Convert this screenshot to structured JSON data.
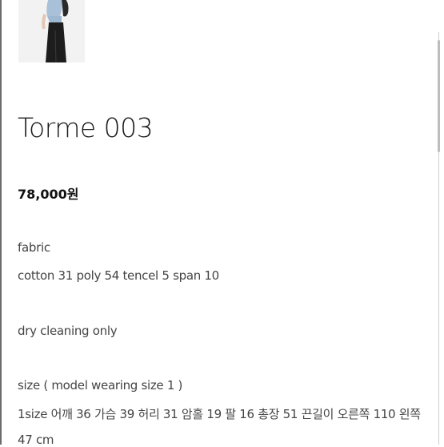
{
  "product": {
    "title": "Torme 003",
    "price": "78,000원"
  },
  "details": {
    "fabric_label": "fabric",
    "composition": "cotton 31 poly 54 tencel 5 span 10",
    "care": "dry cleaning only",
    "size_label": "size ( model wearing size 1 )",
    "size_line1": "1size 어깨 36 가슴 39 허리 31 암홀 19 팔 16 총장 51 끈길이 오른쪽 110 왼쪽",
    "size_line2": "47 cm"
  },
  "icons": {
    "product_image": "product-photo-icon"
  }
}
